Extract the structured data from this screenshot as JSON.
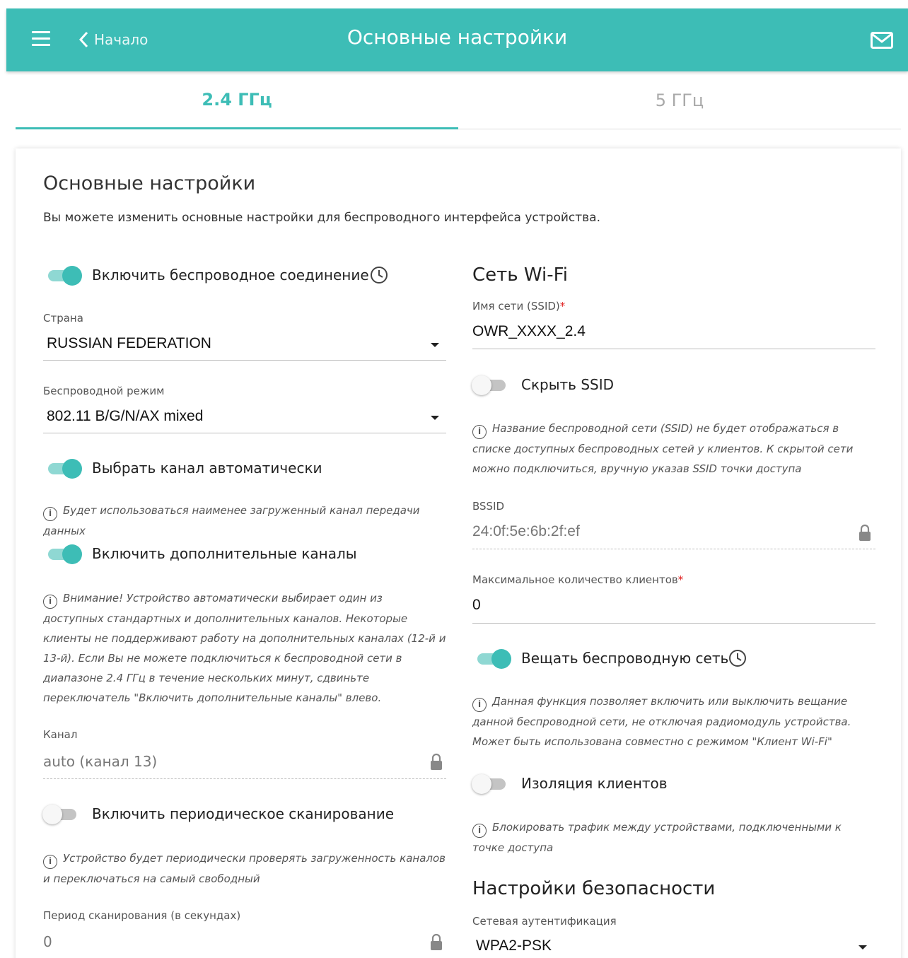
{
  "header": {
    "back_label": "Начало",
    "title": "Основные настройки"
  },
  "tabs": [
    {
      "label": "2.4 ГГц",
      "active": true
    },
    {
      "label": "5 ГГц",
      "active": false
    }
  ],
  "card": {
    "title": "Основные настройки",
    "description": "Вы можете изменить основные настройки для беспроводного интерфейса устройства."
  },
  "left": {
    "enable_wireless": {
      "label": "Включить беспроводное соединение",
      "on": true
    },
    "country": {
      "label": "Страна",
      "value": "RUSSIAN FEDERATION"
    },
    "wireless_mode": {
      "label": "Беспроводной режим",
      "value": "802.11 B/G/N/AX mixed"
    },
    "auto_channel": {
      "label": "Выбрать канал автоматически",
      "on": true,
      "hint": "Будет использоваться наименее загруженный канал передачи данных"
    },
    "extra_channels": {
      "label": "Включить дополнительные каналы",
      "on": true,
      "hint": "Внимание! Устройство автоматически выбирает один из доступных стандартных и дополнительных каналов. Некоторые клиенты не поддерживают работу на дополнительных каналах (12-й и 13-й). Если Вы не можете подключиться к беспроводной сети в диапазоне 2.4 ГГц в течение нескольких минут, сдвиньте переключатель \"Включить дополнительные каналы\" влево."
    },
    "channel": {
      "label": "Канал",
      "value": "auto (канал 13)"
    },
    "periodic_scan": {
      "label": "Включить периодическое сканирование",
      "on": false,
      "hint": "Устройство будет периодически проверять загруженность каналов и переключаться на самый свободный"
    },
    "scan_period": {
      "label": "Период сканирования (в секундах)",
      "value": "0"
    }
  },
  "right": {
    "wifi_section": "Сеть Wi-Fi",
    "ssid": {
      "label": "Имя сети (SSID)",
      "required": "*",
      "value": "OWR_XXXX_2.4"
    },
    "hide_ssid": {
      "label": "Скрыть SSID",
      "on": false,
      "hint": "Название беспроводной сети (SSID) не будет отображаться в списке доступных беспроводных сетей у клиентов. К скрытой сети можно подключиться, вручную указав SSID точки доступа"
    },
    "bssid": {
      "label": "BSSID",
      "value": "24:0f:5e:6b:2f:ef"
    },
    "max_clients": {
      "label": "Максимальное количество клиентов",
      "required": "*",
      "value": "0"
    },
    "broadcast": {
      "label": "Вещать беспроводную сеть",
      "on": true,
      "hint": "Данная функция позволяет включить или выключить вещание данной беспроводной сети, не отключая радиомодуль устройства. Может быть использована совместно с режимом \"Клиент Wi-Fi\""
    },
    "isolation": {
      "label": "Изоляция клиентов",
      "on": false,
      "hint": "Блокировать трафик между устройствами, подключенными к точке доступа"
    },
    "security_section": "Настройки безопасности",
    "auth": {
      "label": "Сетевая аутентификация",
      "value": "WPA2-PSK"
    }
  },
  "colors": {
    "accent": "#3dbdb6",
    "required": "#e02020"
  },
  "icons": [
    "menu-icon",
    "chevron-left-icon",
    "mail-icon",
    "clock-icon",
    "info-icon",
    "lock-icon",
    "caret-down-icon"
  ]
}
